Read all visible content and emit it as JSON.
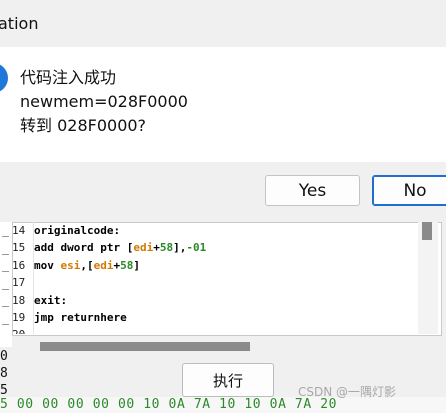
{
  "dialog": {
    "title_fragment": "ation",
    "message_lines": [
      "代码注入成功",
      "newmem=028F0000",
      "转到 028F0000?"
    ],
    "yes_label": "Yes",
    "no_label": "No"
  },
  "editor": {
    "lines": [
      {
        "num": "14",
        "text": "originalcode:"
      },
      {
        "num": "15",
        "text": "add dword ptr [edi+58],-01"
      },
      {
        "num": "16",
        "text": "mov esi,[edi+58]"
      },
      {
        "num": "17",
        "text": ""
      },
      {
        "num": "18",
        "text": "exit:"
      },
      {
        "num": "19",
        "text": "jmp returnhere"
      },
      {
        "num": "20",
        "text": ""
      }
    ]
  },
  "execute_label": "执行",
  "left_partial_digits": [
    "0",
    "8",
    "5"
  ],
  "hex_strip": "5 00 00 00 00 00 10 0A 7A 10 10 0A 7A 20",
  "watermark": "CSDN @一隅灯影",
  "colors": {
    "accent_blue": "#1e78d7",
    "register_orange": "#d07a00",
    "number_green": "#2a8a2a"
  }
}
